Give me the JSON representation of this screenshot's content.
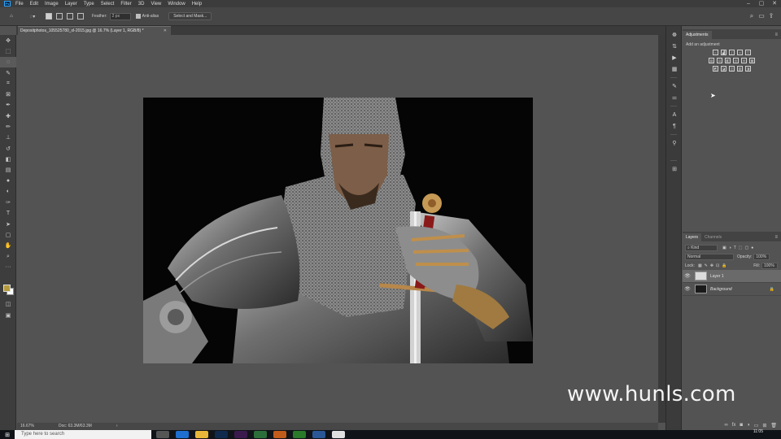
{
  "menubar": {
    "app_icon": "Ps",
    "items": [
      "File",
      "Edit",
      "Image",
      "Layer",
      "Type",
      "Select",
      "Filter",
      "3D",
      "View",
      "Window",
      "Help"
    ],
    "window_controls": [
      "minimize-icon",
      "maximize-icon",
      "close-icon"
    ]
  },
  "options": {
    "feather_label": "Feather:",
    "feather_value": "2 px",
    "antialias_label": "Anti-alias",
    "antialias_checked": true,
    "select_mask_label": "Select and Mask..."
  },
  "document": {
    "tab_title": "Depositphotos_105525780_xl-2015.jpg @ 16.7% (Layer 1, RGB/8) *",
    "zoom": "16.67%",
    "doc_info": "Doc: 63.3M/63.3M"
  },
  "adjustments": {
    "tab_label": "Adjustments",
    "add_label": "Add an adjustment",
    "row1_icons": [
      "brightness-icon",
      "levels-icon",
      "curves-icon",
      "exposure-icon",
      "vibrance-icon"
    ],
    "row2_icons": [
      "hue-icon",
      "color-balance-icon",
      "bw-icon",
      "photo-filter-icon",
      "channel-mixer-icon",
      "color-lookup-icon"
    ],
    "row3_icons": [
      "invert-icon",
      "posterize-icon",
      "threshold-icon",
      "gradient-map-icon",
      "selective-color-icon"
    ]
  },
  "layers_panel": {
    "tabs": [
      "Layers",
      "Channels"
    ],
    "filter_kind": "Kind",
    "blend_mode": "Normal",
    "opacity_label": "Opacity:",
    "opacity_value": "100%",
    "lock_label": "Lock:",
    "fill_label": "Fill:",
    "fill_value": "100%",
    "layers": [
      {
        "name": "Layer 1",
        "selected": true
      },
      {
        "name": "Background",
        "selected": false,
        "locked": true
      }
    ]
  },
  "watermark": "www.hunls.com",
  "taskbar": {
    "search_placeholder": "Type here to search",
    "time": "11:05"
  },
  "colors": {
    "foreground_swatch": "#b49a3c",
    "background_swatch": "#ffffff",
    "accent": "#31a8ff"
  }
}
